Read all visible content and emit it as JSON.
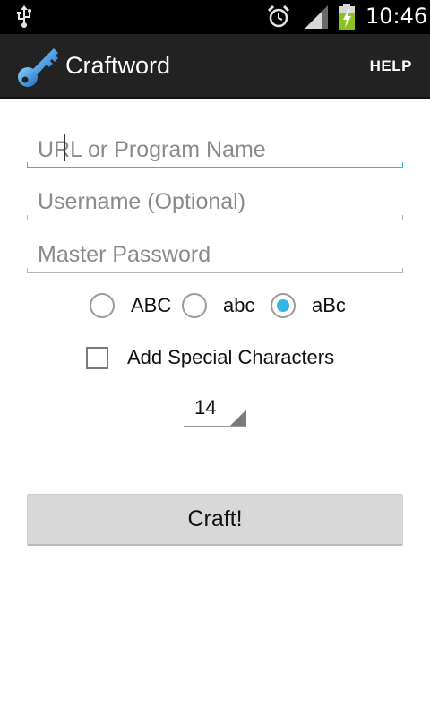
{
  "status_bar": {
    "time": "10:46",
    "icons": [
      "usb-icon",
      "alarm-icon",
      "signal-icon",
      "battery-charging-icon"
    ]
  },
  "action_bar": {
    "title": "Craftword",
    "app_icon": "key-icon",
    "help_label": "HELP"
  },
  "form": {
    "url_placeholder": "URL or Program Name",
    "url_value": "",
    "username_placeholder": "Username (Optional)",
    "username_value": "",
    "password_placeholder": "Master Password",
    "password_value": "",
    "case_options": [
      {
        "label": "ABC",
        "selected": false
      },
      {
        "label": "abc",
        "selected": false
      },
      {
        "label": "aBc",
        "selected": true
      }
    ],
    "special_chars_label": "Add Special Characters",
    "special_chars_checked": false,
    "length_value": "14",
    "craft_label": "Craft!"
  },
  "colors": {
    "accent": "#33b5e5",
    "action_bar": "#222222",
    "status_bar": "#000000",
    "button": "#d8d8d8"
  }
}
